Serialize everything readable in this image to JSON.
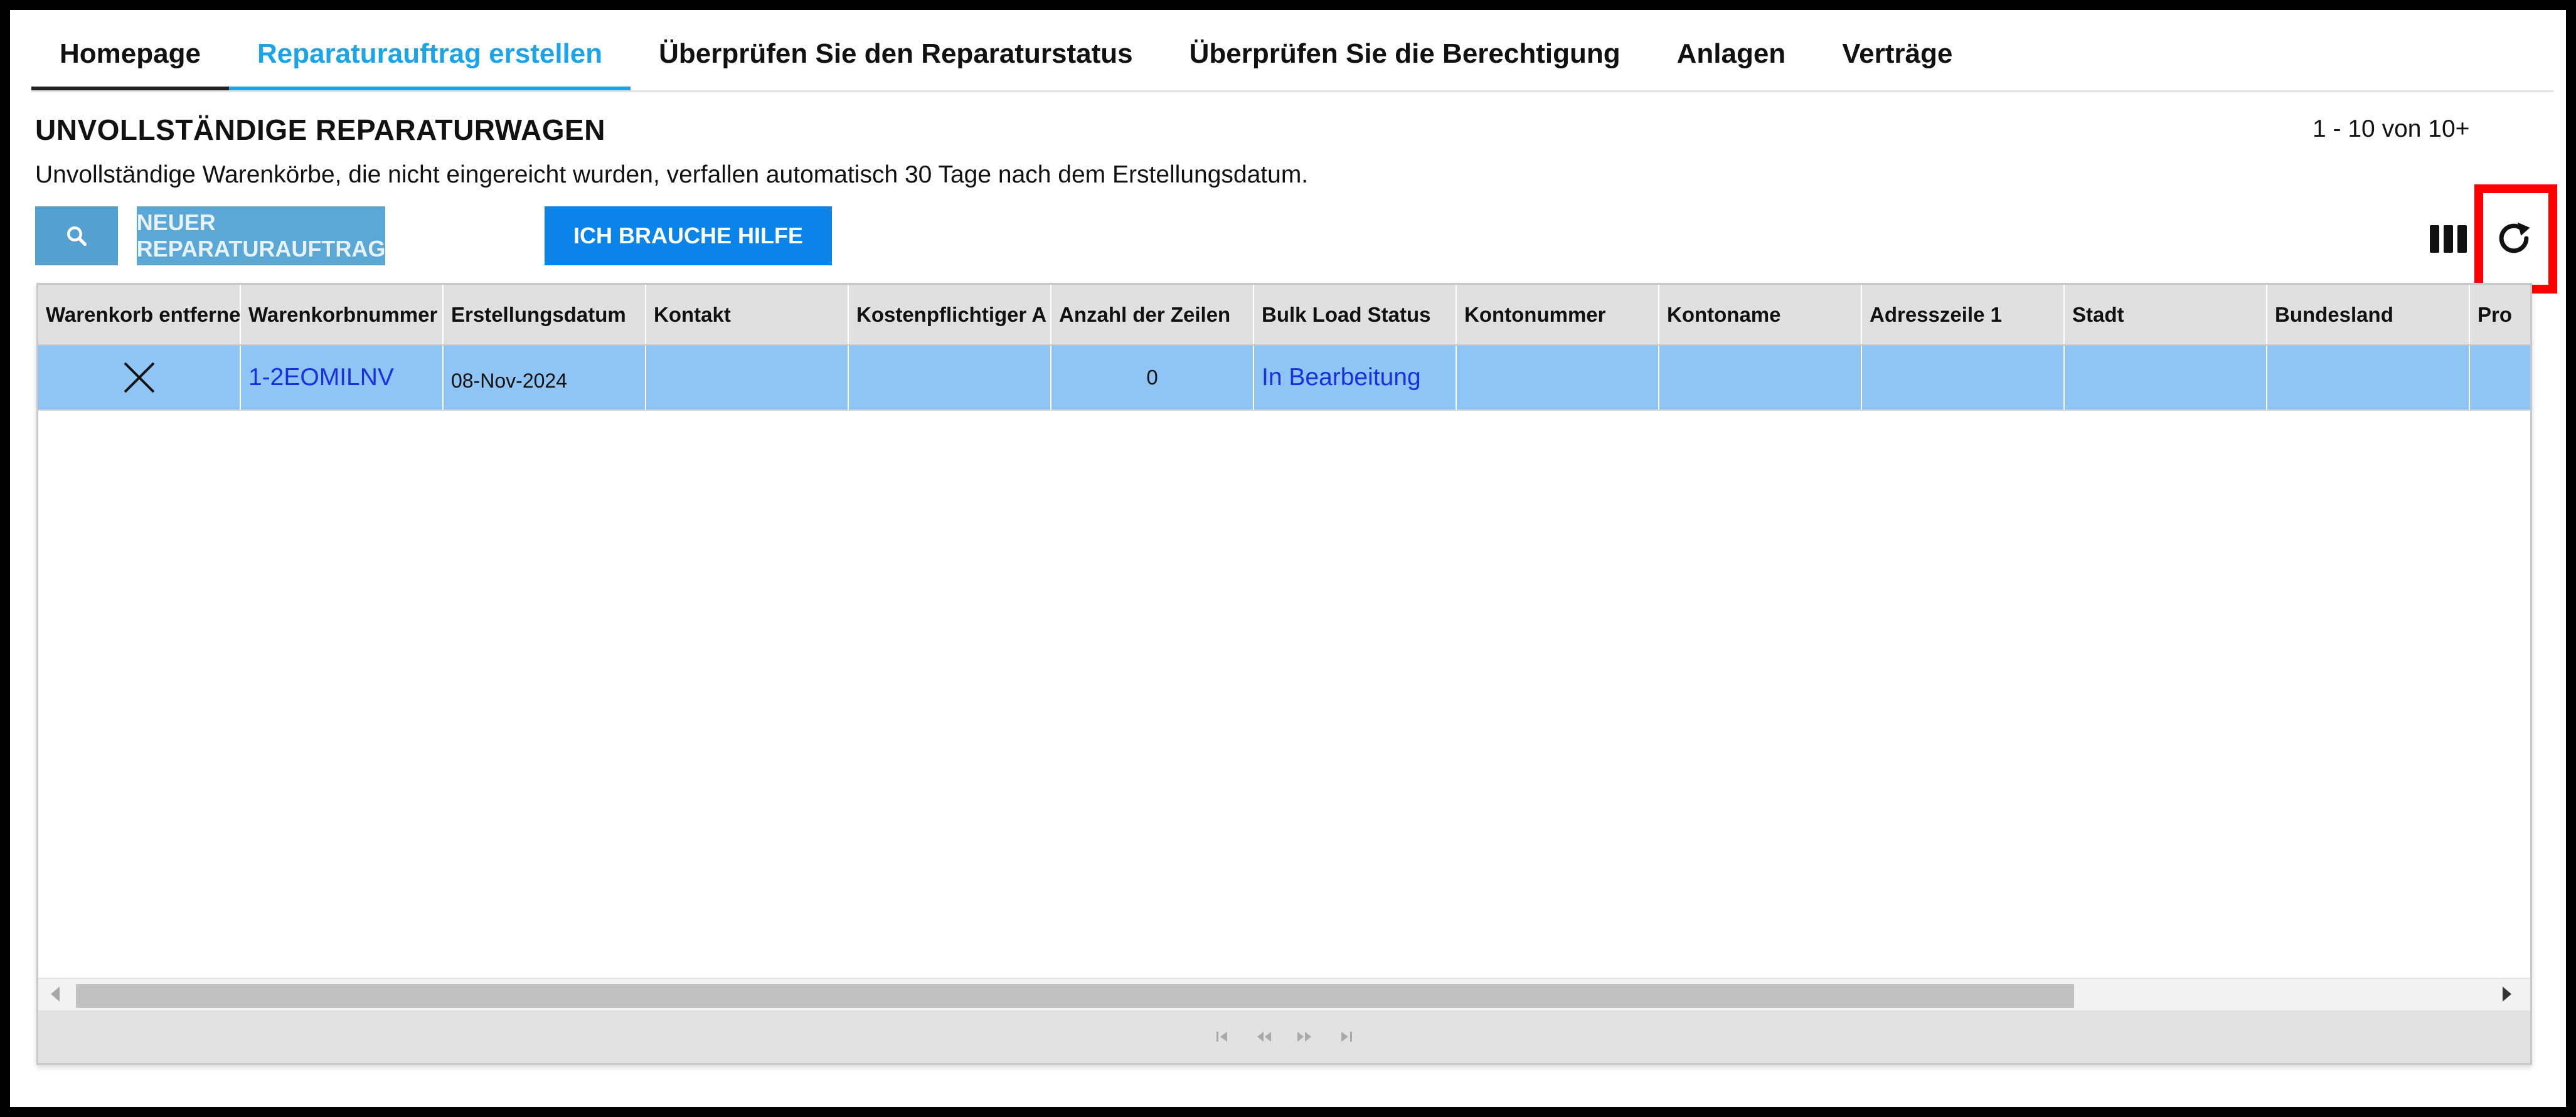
{
  "nav": {
    "tabs": [
      {
        "label": "Homepage"
      },
      {
        "label": "Reparaturauftrag erstellen"
      },
      {
        "label": "Überprüfen Sie den Reparaturstatus"
      },
      {
        "label": "Überprüfen Sie die Berechtigung"
      },
      {
        "label": "Anlagen"
      },
      {
        "label": "Verträge"
      }
    ],
    "active_index": 1
  },
  "page": {
    "title": "UNVOLLSTÄNDIGE REPARATURWAGEN",
    "subtitle": "Unvollständige Warenkörbe, die nicht eingereicht wurden, verfallen automatisch 30 Tage nach dem Erstellungsdatum.",
    "count": "1 - 10 von 10+"
  },
  "toolbar": {
    "search_icon": "search-icon",
    "new_label": "NEUER REPARATURAUFTRAG",
    "help_label": "ICH BRAUCHE HILFE",
    "columns_icon": "columns-icon",
    "refresh_icon": "refresh-icon"
  },
  "colors": {
    "active_tab": "#1ba4e8",
    "help_button": "#0a84e8",
    "selected_row": "#8ec5f4",
    "link": "#1a2ee6",
    "highlight": "#ff0000"
  },
  "table": {
    "columns": [
      "Warenkorb entfernen",
      "Warenkorbnummer",
      "Erstellungsdatum",
      "Kontakt",
      "Kostenpflichtiger A",
      "Anzahl der Zeilen",
      "Bulk Load Status",
      "Kontonummer",
      "Kontoname",
      "Adresszeile 1",
      "Stadt",
      "Bundesland",
      "Pro"
    ],
    "rows": [
      {
        "remove_icon": "close-icon",
        "cart_number": "1-2EOMILNV",
        "created": "08-Nov-2024",
        "contact": "",
        "payer": "",
        "line_count": "0",
        "bulk_status": "In Bearbeitung",
        "account_number": "",
        "account_name": "",
        "address1": "",
        "city": "",
        "state": "",
        "pro": ""
      }
    ]
  },
  "pager": {
    "icons": [
      "first-page-icon",
      "prev-page-icon",
      "next-page-icon",
      "last-page-icon"
    ]
  }
}
